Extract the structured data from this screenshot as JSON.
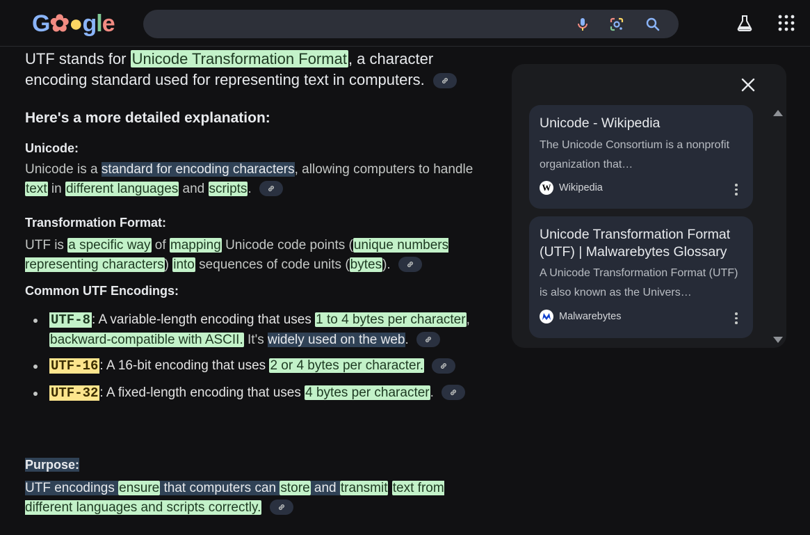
{
  "header": {
    "logo_text": "Google",
    "search_value": "",
    "icons": [
      "mic-icon",
      "lens-icon",
      "search-icon",
      "labs-flask-icon",
      "apps-grid-icon"
    ]
  },
  "answer": {
    "intro_prefix": "UTF stands for ",
    "intro_highlight": "Unicode Transformation Format",
    "intro_suffix": ", a character encoding standard used for representing text in computers.",
    "detail_heading": "Here's a more detailed explanation:",
    "unicode": {
      "heading": "Unicode:",
      "t1": "Unicode is a ",
      "s1": "standard for encoding characters",
      "t2": ", allowing computers to handle ",
      "h1": "text",
      "t3": " in ",
      "h2": "different languages",
      "t4": " and ",
      "h3": "scripts",
      "t5": "."
    },
    "transformation": {
      "heading": "Transformation Format:",
      "t1": "UTF is ",
      "h1": "a specific way",
      "t2": " of ",
      "h2": "mapping",
      "t3": " Unicode code points (",
      "h3": "unique numbers representing characters",
      "t4": ") ",
      "h4": "into",
      "t5": " sequences of code units (",
      "h5": "bytes",
      "t6": ")."
    },
    "encodings": {
      "heading": "Common UTF Encodings:",
      "items": [
        {
          "code": "UTF-8",
          "t1": ": A variable-length encoding that uses ",
          "h1": "1 to 4 bytes per character",
          "t2": ", ",
          "h2": "backward-compatible with ASCII.",
          "t3": " It's ",
          "s1": "widely used on the web",
          "t4": "."
        },
        {
          "code": "UTF-16",
          "t1": ": A 16-bit encoding that uses ",
          "h1": "2 or 4 bytes per character.",
          "t2": ""
        },
        {
          "code": "UTF-32",
          "t1": ": A fixed-length encoding that uses ",
          "h1": "4 bytes per character",
          "t2": "."
        }
      ]
    },
    "purpose": {
      "heading": "Purpose:",
      "t1": "UTF encodings ",
      "h1": "ensure",
      "t2": " that computers can ",
      "h2": "store",
      "t3": " and ",
      "h3": "transmit",
      "t4": " ",
      "h4": "text from different languages and scripts correctly."
    }
  },
  "sources_panel": {
    "cards": [
      {
        "title": "Unicode - Wikipedia",
        "snippet": "The Unicode Consortium is a nonprofit organization that…",
        "source": "Wikipedia"
      },
      {
        "title": "Unicode Transformation Format (UTF) | Malwarebytes Glossary",
        "snippet": "A Unicode Transformation Format (UTF) is also known as the Univers…",
        "source": "Malwarebytes"
      }
    ]
  },
  "colors": {
    "background": "#111113",
    "highlight_green": "#c3f2c9",
    "highlight_yellow": "#fde58d",
    "selection_blue": "#304256",
    "card_bg": "#262b37"
  }
}
